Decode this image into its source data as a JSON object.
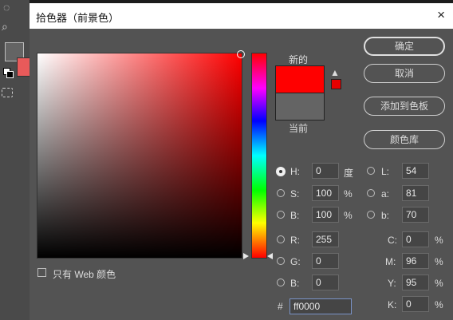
{
  "dialog": {
    "title": "拾色器（前景色）"
  },
  "preview": {
    "new_label": "新的",
    "current_label": "当前",
    "new_color": "#ff0000",
    "current_color": "#646464"
  },
  "buttons": {
    "ok": "确定",
    "cancel": "取消",
    "add_swatch": "添加到色板",
    "libraries": "颜色库"
  },
  "hsb": {
    "h": {
      "label": "H:",
      "value": "0",
      "unit": "度"
    },
    "s": {
      "label": "S:",
      "value": "100",
      "unit": "%"
    },
    "b": {
      "label": "B:",
      "value": "100",
      "unit": "%"
    }
  },
  "rgb": {
    "r": {
      "label": "R:",
      "value": "255"
    },
    "g": {
      "label": "G:",
      "value": "0"
    },
    "b": {
      "label": "B:",
      "value": "0"
    }
  },
  "lab": {
    "l": {
      "label": "L:",
      "value": "54"
    },
    "a": {
      "label": "a:",
      "value": "81"
    },
    "b": {
      "label": "b:",
      "value": "70"
    }
  },
  "cmyk": {
    "c": {
      "label": "C:",
      "value": "0",
      "unit": "%"
    },
    "m": {
      "label": "M:",
      "value": "96",
      "unit": "%"
    },
    "y": {
      "label": "Y:",
      "value": "95",
      "unit": "%"
    },
    "k": {
      "label": "K:",
      "value": "0",
      "unit": "%"
    }
  },
  "hex": {
    "label": "#",
    "value": "ff0000"
  },
  "web_only": {
    "label": "只有 Web 颜色",
    "checked": false
  },
  "icons": {
    "close": "×",
    "warning": "▲"
  }
}
